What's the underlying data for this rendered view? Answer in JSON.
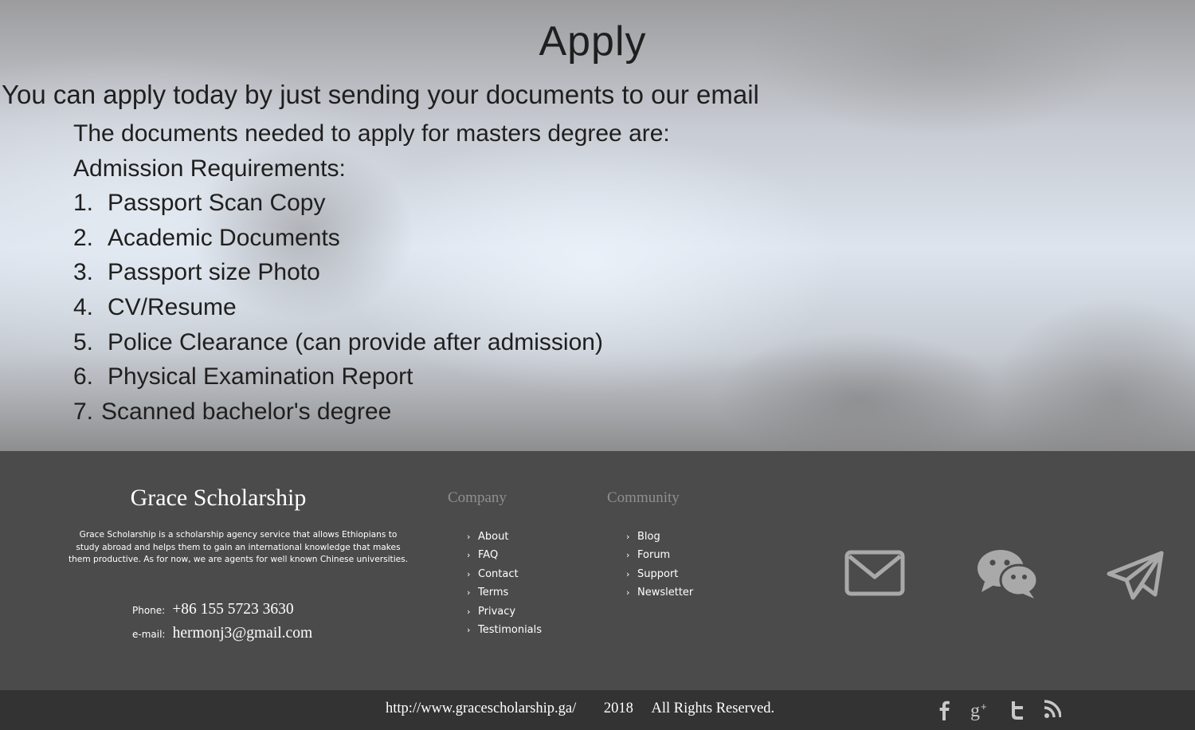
{
  "apply": {
    "title": "Apply",
    "lead": "You can apply today by just sending your documents to our email",
    "intro": "The documents needed to apply for masters degree are:",
    "requirements_heading": "Admission Requirements:",
    "requirements": [
      {
        "num": "1.",
        "text": "Passport Scan Copy"
      },
      {
        "num": "2.",
        "text": "Academic Documents"
      },
      {
        "num": "3.",
        "text": "Passport size Photo"
      },
      {
        "num": "4.",
        "text": "CV/Resume"
      },
      {
        "num": "5.",
        "text": "Police Clearance (can provide after admission)"
      },
      {
        "num": "6.",
        "text": "Physical Examination Report"
      },
      {
        "num": "7.",
        "text": "Scanned bachelor's degree"
      }
    ]
  },
  "footer": {
    "brand": "Grace Scholarship",
    "description": "Grace Scholarship is a scholarship agency service that allows Ethiopians to study abroad and helps them to gain an international knowledge that makes them productive. As for now, we are agents for well known Chinese universities.",
    "phone_label": "Phone:",
    "phone": "+86 155 5723 3630",
    "email_label": "e-mail:",
    "email": "hermonj3@gmail.com",
    "company": {
      "heading": "Company",
      "links": [
        "About",
        "FAQ",
        "Contact",
        "Terms",
        "Privacy",
        "Testimonials"
      ]
    },
    "community": {
      "heading": "Community",
      "links": [
        "Blog",
        "Forum",
        "Support",
        "Newsletter"
      ]
    },
    "contact_icons": [
      "mail-icon",
      "wechat-icon",
      "telegram-icon"
    ],
    "icon_color": "#a9a9a9"
  },
  "bottom_bar": {
    "url": "http://www.gracescholarship.ga/",
    "year": "2018",
    "rights": "All Rights Reserved.",
    "social_icons": [
      "facebook-icon",
      "google-plus-icon",
      "twitter-icon",
      "rss-icon"
    ]
  }
}
